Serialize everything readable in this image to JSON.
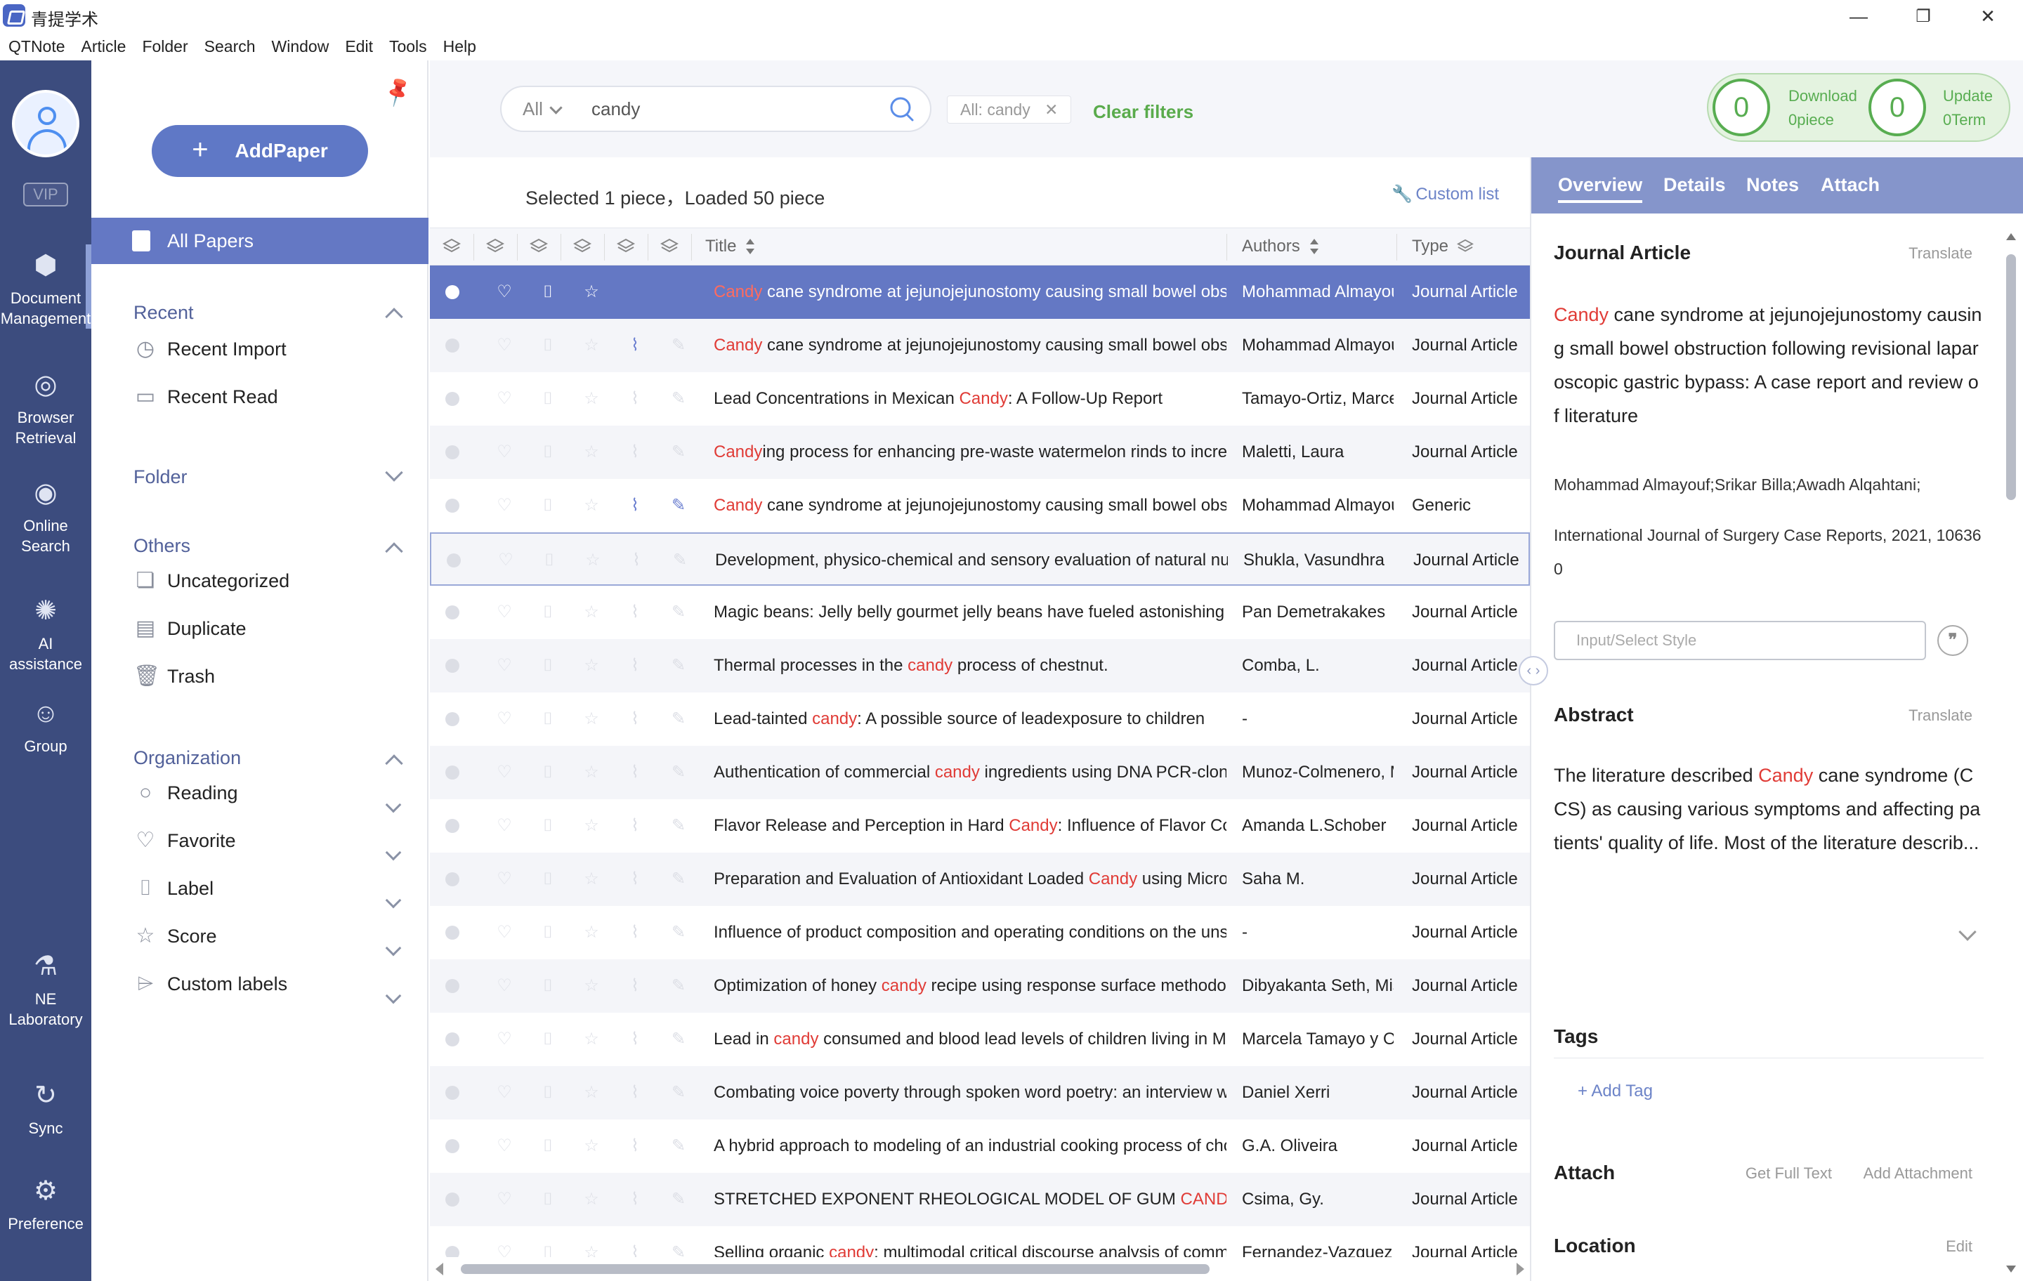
{
  "app": {
    "title": "青提学术",
    "minimize": "—",
    "maximize": "❐",
    "close": "✕"
  },
  "menu": [
    "QTNote",
    "Article",
    "Folder",
    "Search",
    "Window",
    "Edit",
    "Tools",
    "Help"
  ],
  "rail": {
    "vip": "VIP",
    "items": [
      {
        "label": "Document Management",
        "icon": "box-icon"
      },
      {
        "label": "Browser Retrieval",
        "icon": "globe-icon"
      },
      {
        "label": "Online Search",
        "icon": "eye-icon"
      },
      {
        "label": "AI assistance",
        "icon": "bulb-icon"
      },
      {
        "label": "Group",
        "icon": "users-icon"
      },
      {
        "label": "NE Laboratory",
        "icon": "microscope-icon"
      },
      {
        "label": "Sync",
        "icon": "sync-icon"
      },
      {
        "label": "Preference",
        "icon": "gear-icon"
      }
    ]
  },
  "sidebar": {
    "add_paper": "AddPaper",
    "all_papers": "All Papers",
    "recent": {
      "label": "Recent",
      "items": [
        "Recent Import",
        "Recent Read"
      ]
    },
    "folder": {
      "label": "Folder"
    },
    "others": {
      "label": "Others",
      "items": [
        "Uncategorized",
        "Duplicate",
        "Trash"
      ]
    },
    "organization": {
      "label": "Organization",
      "items": [
        "Reading",
        "Favorite",
        "Label",
        "Score",
        "Custom labels"
      ]
    }
  },
  "search": {
    "scope": "All",
    "value": "candy",
    "filter_chip": "All: candy",
    "clear_filters": "Clear filters"
  },
  "counters": {
    "download": {
      "count": "0",
      "label": "Download",
      "sub": "0piece"
    },
    "update": {
      "count": "0",
      "label": "Update",
      "sub": "0Term"
    }
  },
  "list": {
    "selection_info": "Selected 1 piece，Loaded 50 piece",
    "custom_list": "Custom list",
    "columns": {
      "title": "Title",
      "authors": "Authors",
      "type": "Type"
    },
    "rows": [
      {
        "hl": "Candy",
        "rest": " cane syndrome at jejunojejunostomy causing small bowel obstruction following revisional laparoscopic gastric bypass",
        "pre": "",
        "author": "Mohammad Almayouf",
        "type": "Journal Article"
      },
      {
        "hl": "Candy",
        "rest": " cane syndrome at jejunojejunostomy causing small bowel obstruction",
        "pre": "",
        "author": "Mohammad Almayouf",
        "type": "Journal Article"
      },
      {
        "pre": "Lead Concentrations in Mexican ",
        "hl": "Candy",
        "rest": ": A Follow-Up Report",
        "author": "Tamayo-Ortiz, Marcela",
        "type": "Journal Article"
      },
      {
        "pre": "",
        "hl": "Candy",
        "rest": "ing process for enhancing pre-waste watermelon rinds to increase",
        "author": "Maletti, Laura",
        "type": "Journal Article"
      },
      {
        "pre": "",
        "hl": "Candy",
        "rest": " cane syndrome at jejunojejunostomy causing small bowel obstruction",
        "author": "Mohammad Almayouf",
        "type": "Generic"
      },
      {
        "pre": "Development, physico-chemical and sensory evaluation of natural nutrient",
        "hl": "",
        "rest": "",
        "author": "Shukla, Vasundhra",
        "type": "Journal Article"
      },
      {
        "pre": "Magic beans: Jelly belly gourmet jelly beans have fueled astonishing growth",
        "hl": "",
        "rest": "",
        "author": "Pan Demetrakakes",
        "type": "Journal Article"
      },
      {
        "pre": "Thermal processes in the ",
        "hl": "candy",
        "rest": " process of chestnut.",
        "author": "Comba, L.",
        "type": "Journal Article"
      },
      {
        "pre": "Lead-tainted ",
        "hl": "candy",
        "rest": ": A possible source of leadexposure to children",
        "author": "-",
        "type": "Journal Article"
      },
      {
        "pre": "Authentication of commercial ",
        "hl": "candy",
        "rest": " ingredients using DNA PCR-cloning",
        "author": "Munoz-Colmenero, Marta",
        "type": "Journal Article"
      },
      {
        "pre": "Flavor Release and Perception in Hard ",
        "hl": "Candy",
        "rest": ": Influence of Flavor Compound",
        "author": "Amanda L.Schober",
        "type": "Journal Article"
      },
      {
        "pre": "Preparation and Evaluation of Antioxidant Loaded ",
        "hl": "Candy",
        "rest": " using Microwave",
        "author": "Saha M.",
        "type": "Journal Article"
      },
      {
        "pre": "Influence of product composition and operating conditions on the unsteady",
        "hl": "",
        "rest": "",
        "author": "-",
        "type": "Journal Article"
      },
      {
        "pre": "Optimization of honey ",
        "hl": "candy",
        "rest": " recipe using response surface methodology",
        "author": "Dibyakanta Seth, Mistry",
        "type": "Journal Article"
      },
      {
        "pre": "Lead in ",
        "hl": "candy",
        "rest": " consumed and blood lead levels of children living in Mexico",
        "author": "Marcela Tamayo y Ortiz",
        "type": "Journal Article"
      },
      {
        "pre": "Combating voice poverty through spoken word poetry: an interview with",
        "hl": "",
        "rest": "",
        "author": "Daniel Xerri",
        "type": "Journal Article"
      },
      {
        "pre": "A hybrid approach to modeling of an industrial cooking process of chocolate",
        "hl": "",
        "rest": "",
        "author": "G.A. Oliveira",
        "type": "Journal Article"
      },
      {
        "pre": "STRETCHED EXPONENT RHEOLOGICAL MODEL OF GUM ",
        "hl": "CANDY",
        "rest": "",
        "author": "Csima, Gy.",
        "type": "Journal Article"
      },
      {
        "pre": "Selling organic ",
        "hl": "candy",
        "rest": ": multimodal critical discourse analysis of commercial",
        "author": "Fernandez-Vazquez, J.",
        "type": "Journal Article"
      }
    ]
  },
  "detail": {
    "tabs": [
      "Overview",
      "Details",
      "Notes",
      "Attach"
    ],
    "type_heading": "Journal Article",
    "translate": "Translate",
    "title_hl": "Candy",
    "title_rest": " cane syndrome at jejunojejunostomy causing small bowel obstruction following revisional laparoscopic gastric bypass: A case report and review of literature",
    "authors": "Mohammad Almayouf;Srikar Billa;Awadh Alqahtani;",
    "source": "International Journal of Surgery Case Reports, 2021, 106360",
    "style_placeholder": "Input/Select Style",
    "quote_icon": "❞",
    "abstract_heading": "Abstract",
    "abstract_pre": "The literature described ",
    "abstract_hl": "Candy",
    "abstract_rest": " cane syndrome (CCS) as causing various symptoms and affecting patients' quality of life. Most of the literature describ...",
    "tags_heading": "Tags",
    "add_tag": "+ Add Tag",
    "attach_heading": "Attach",
    "get_full_text": "Get Full Text",
    "add_attachment": "Add Attachment",
    "location_heading": "Location",
    "edit": "Edit"
  }
}
